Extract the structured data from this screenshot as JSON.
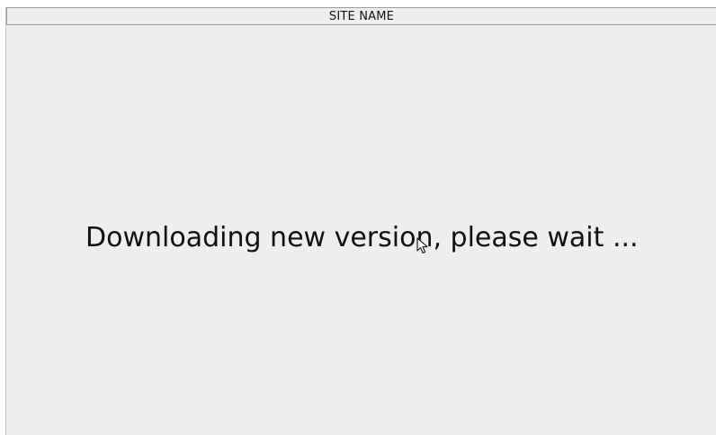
{
  "window": {
    "title": "SITE NAME"
  },
  "main": {
    "message": "Downloading new version, please wait ..."
  },
  "icons": {
    "cursor": "mouse-pointer-icon"
  },
  "colors": {
    "background": "#eeeeee",
    "text": "#111111",
    "border": "#9e9e9e"
  }
}
